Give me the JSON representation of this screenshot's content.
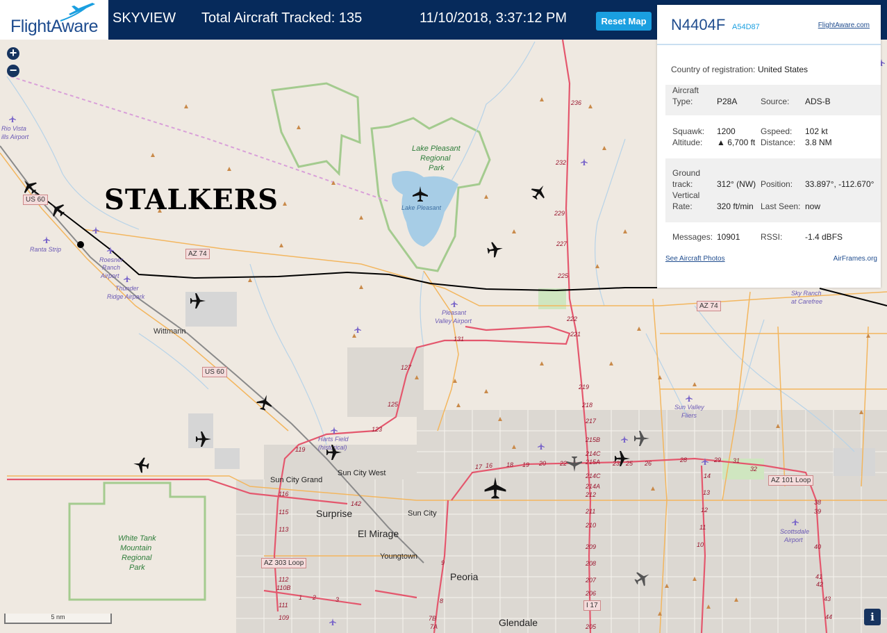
{
  "header": {
    "logo_text": "FlightAware",
    "app_name": "SKYVIEW",
    "tracked_label": "Total Aircraft Tracked: 135",
    "datetime": "11/10/2018, 3:37:12 PM",
    "reset_label": "Reset Map"
  },
  "colors": {
    "header_bg": "#062a5b",
    "accent": "#1a9fe0",
    "highway": "#e4576d",
    "road": "#f3b65e",
    "park": "#9fc48c",
    "water": "#a7cde6"
  },
  "annotation": "STALKERS",
  "panel": {
    "registration": "N4404F",
    "hex": "A54D87",
    "fa_link": "FlightAware.com",
    "country_label": "Country of registration:",
    "country": "United States",
    "aircraft_type_label_1": "Aircraft",
    "aircraft_type_label_2": "Type:",
    "aircraft_type": "P28A",
    "source_label": "Source:",
    "source": "ADS-B",
    "squawk_label": "Squawk:",
    "squawk": "1200",
    "gspeed_label": "Gspeed:",
    "gspeed": "102 kt",
    "altitude_label": "Altitude:",
    "altitude": "▲ 6,700 ft",
    "distance_label": "Distance:",
    "distance": "3.8 NM",
    "ground_track_label_1": "Ground",
    "ground_track_label_2": "track:",
    "ground_track": "312° (NW)",
    "position_label": "Position:",
    "position": "33.897°, -112.670°",
    "vrate_label_1": "Vertical",
    "vrate_label_2": "Rate:",
    "vrate": "320 ft/min",
    "last_seen_label": "Last Seen:",
    "last_seen": "now",
    "messages_label": "Messages:",
    "messages": "10901",
    "rssi_label": "RSSI:",
    "rssi": "-1.4 dBFS",
    "photos_link": "See Aircraft Photos",
    "airframes_link": "AirFrames.org"
  },
  "map": {
    "scale": "5 nm",
    "zoom_in": "+",
    "zoom_out": "−",
    "info": "i",
    "places": [
      "Rio Vista",
      "ills Airport",
      "Lake Pleasant",
      "Regional",
      "Park",
      "Lake Pleasant",
      "Ranta Strip",
      "Roesner",
      "Ranch",
      "Airport",
      "Thunder",
      "Ridge Airpark",
      "Wittmann",
      "Pleasant",
      "Valley Airport",
      "Sky Ranch",
      "at Carefree",
      "Sun Valley",
      "Fliers",
      "Harts Field",
      "(historical)",
      "Sun City Grand",
      "Sun City West",
      "Surprise",
      "Sun City",
      "El Mirage",
      "Youngtown",
      "White Tank",
      "Mountain",
      "Regional",
      "Park",
      "Peoria",
      "Glendale",
      "Scottsdale",
      "Airport"
    ],
    "shields": [
      "US 60",
      "AZ 74",
      "AZ 74",
      "US 60",
      "AZ 101 Loop",
      "AZ 303 Loop",
      "I 17"
    ],
    "route_numbers": [
      "236",
      "232",
      "229",
      "227",
      "225",
      "222",
      "221",
      "219",
      "218",
      "217",
      "215B",
      "214C",
      "215A",
      "214C",
      "214A",
      "212",
      "211",
      "210",
      "209",
      "208",
      "207",
      "206",
      "205",
      "131",
      "127",
      "125",
      "123",
      "119",
      "116",
      "115",
      "113",
      "112",
      "110B",
      "111",
      "109",
      "142",
      "17",
      "16",
      "18",
      "19",
      "20",
      "22",
      "23",
      "25",
      "26",
      "28",
      "29",
      "31",
      "32",
      "14",
      "13",
      "12",
      "11",
      "10",
      "9",
      "8",
      "7B",
      "7A",
      "1",
      "2",
      "3",
      "38",
      "39",
      "40",
      "41",
      "42",
      "43",
      "44"
    ]
  }
}
